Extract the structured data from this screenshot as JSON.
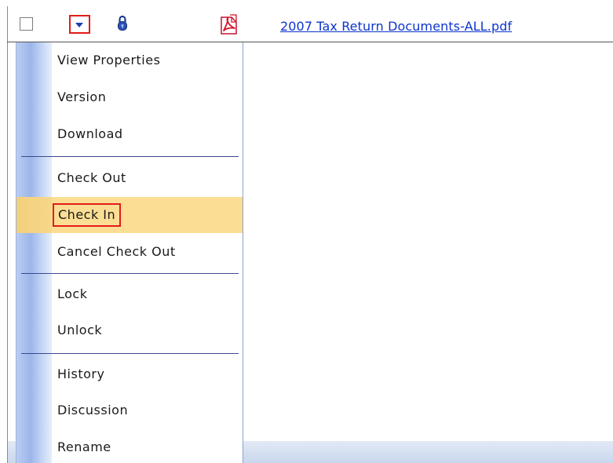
{
  "file_row": {
    "checkbox_checked": false,
    "file_name": "2007 Tax Return Documents-ALL.pdf",
    "icons": [
      "dropdown-arrow-icon",
      "lock-icon",
      "pdf-file-icon"
    ]
  },
  "context_menu": {
    "items": [
      {
        "label": "View Properties"
      },
      {
        "label": "Version"
      },
      {
        "label": "Download"
      },
      {
        "label": "Check Out"
      },
      {
        "label": "Check In",
        "highlighted": true
      },
      {
        "label": "Cancel Check Out"
      },
      {
        "label": "Lock"
      },
      {
        "label": "Unlock"
      },
      {
        "label": "History"
      },
      {
        "label": "Discussion"
      },
      {
        "label": "Rename"
      }
    ]
  },
  "colors": {
    "highlight_fill": "#fbde94",
    "annotation_box": "#e31b1b",
    "link_text": "#0d34cc",
    "separator": "#3b4a8e"
  }
}
